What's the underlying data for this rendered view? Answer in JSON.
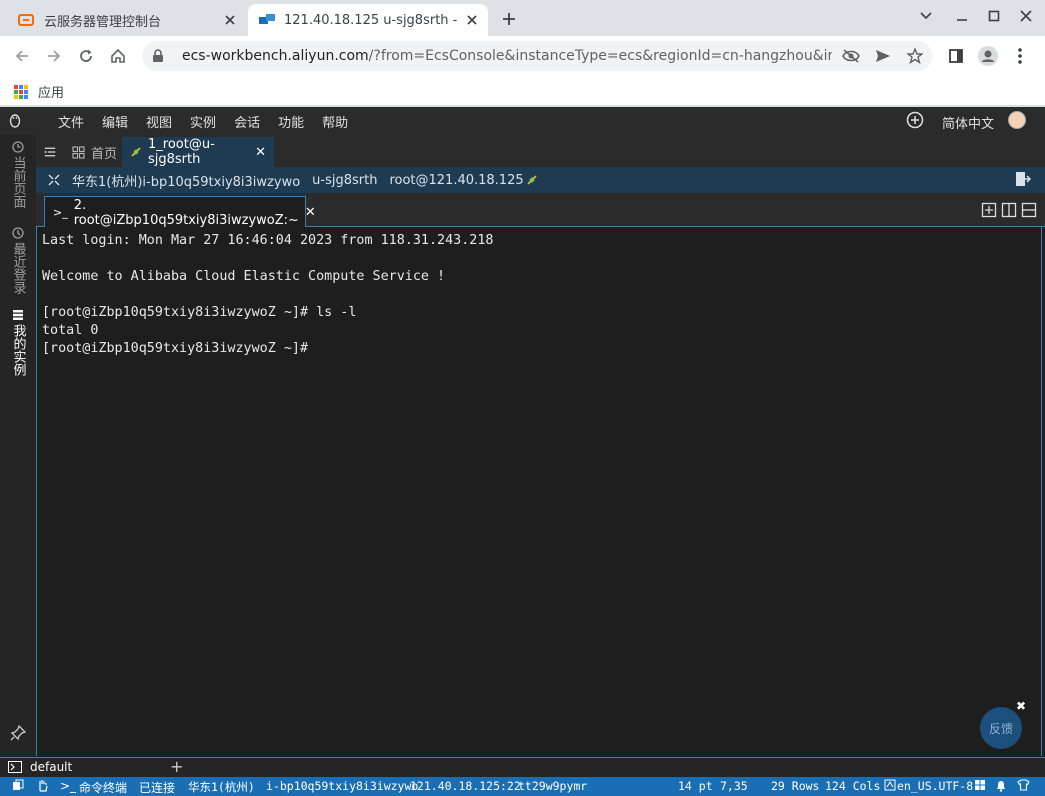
{
  "browser": {
    "tabs": [
      {
        "title": "云服务器管理控制台"
      },
      {
        "title": "121.40.18.125 u-sjg8srth - E"
      }
    ],
    "url_host": "ecs-workbench.aliyun.com",
    "url_rest": "/?from=EcsConsole&instanceType=ecs&regionId=cn-hangzhou&instanceId=i…",
    "bookmarks": {
      "apps": "应用"
    }
  },
  "workbench": {
    "menu": [
      "文件",
      "编辑",
      "视图",
      "实例",
      "会话",
      "功能",
      "帮助"
    ],
    "language": "简体中文",
    "left_rail": {
      "current_page": "当前页面",
      "recent_login": "最近登录",
      "my_instances": "我的实例"
    },
    "tabs": {
      "home": "首页",
      "session": "1_root@u-sjg8srth"
    },
    "info": {
      "region_instance": "华东1(杭州)i-bp10q59txiy8i3iwzywo",
      "user": "u-sjg8srth",
      "login": "root@121.40.18.125"
    },
    "terminal_tab": "2. root@iZbp10q59txiy8i3iwzywoZ:~",
    "terminal_lines": [
      "Last login: Mon Mar 27 16:46:04 2023 from 118.31.243.218",
      "",
      "Welcome to Alibaba Cloud Elastic Compute Service !",
      "",
      "[root@iZbp10q59txiy8i3iwzywoZ ~]# ls -l",
      "total 0",
      "[root@iZbp10q59txiy8i3iwzywoZ ~]#"
    ],
    "feedback": "反馈",
    "session_name": "default",
    "status": {
      "terminal": "命令终端",
      "connected": "已连接",
      "region": "华东1(杭州)",
      "instance": "i-bp10q59txiy8i3iwzywo",
      "address": "121.40.18.125:22",
      "code": "tt29w9pymr",
      "font_size": "14 pt",
      "cursor": "7,35",
      "rows": "29 Rows",
      "cols": "124 Cols",
      "encoding": "en_US.UTF-8"
    }
  },
  "colors": {
    "accent": "#1a6fb4",
    "tab_active": "#1f3b52",
    "aliyun_orange": "#ff6a00"
  }
}
